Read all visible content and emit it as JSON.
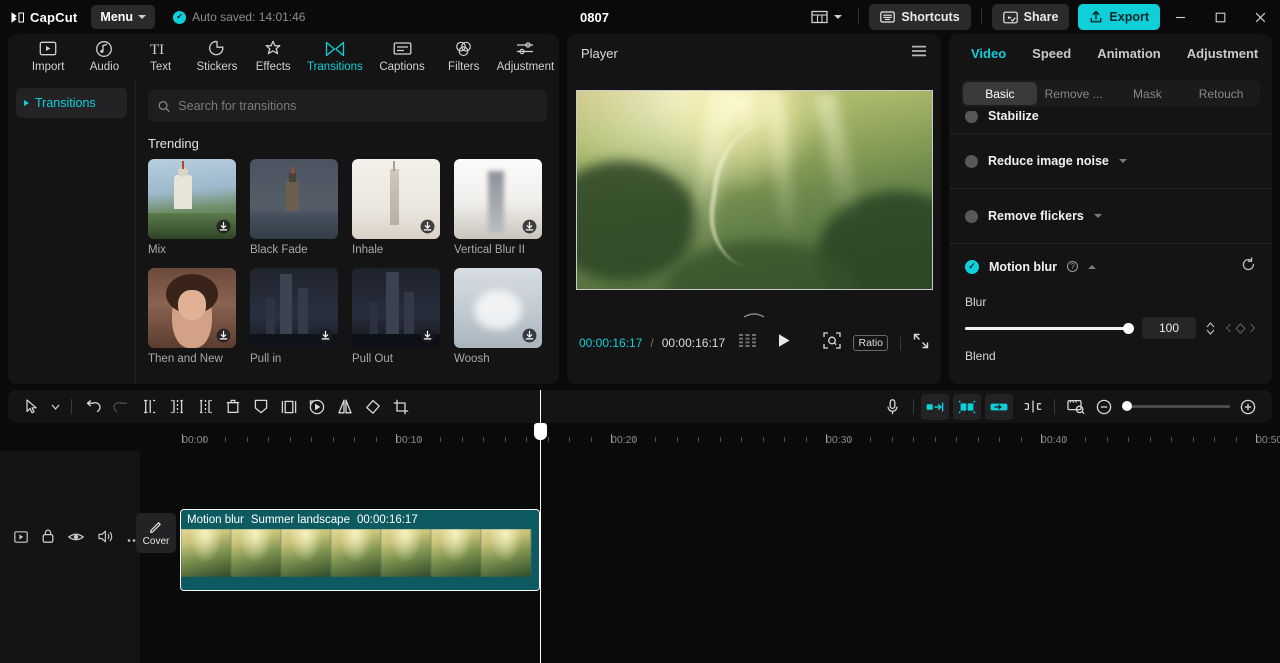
{
  "titlebar": {
    "brand": "CapCut",
    "menu_label": "Menu",
    "autosave_text": "Auto saved: 14:01:46",
    "project_title": "0807",
    "shortcuts_label": "Shortcuts",
    "share_label": "Share",
    "export_label": "Export",
    "icons": {
      "layout": "layout-icon",
      "shortcuts": "keyboard-icon",
      "share": "share-icon",
      "export": "upload-icon",
      "minimize": "–",
      "maximize": "❑",
      "close": "✕"
    },
    "accent_color": "#0fd0d8"
  },
  "nav_tabs": [
    {
      "label": "Import",
      "icon": "import-icon",
      "active": false
    },
    {
      "label": "Audio",
      "icon": "audio-icon",
      "active": false
    },
    {
      "label": "Text",
      "icon": "text-icon",
      "active": false
    },
    {
      "label": "Stickers",
      "icon": "stickers-icon",
      "active": false
    },
    {
      "label": "Effects",
      "icon": "effects-icon",
      "active": false
    },
    {
      "label": "Transitions",
      "icon": "transitions-icon",
      "active": true
    },
    {
      "label": "Captions",
      "icon": "captions-icon",
      "active": false
    },
    {
      "label": "Filters",
      "icon": "filters-icon",
      "active": false
    },
    {
      "label": "Adjustment",
      "icon": "adjustment-icon",
      "active": false
    }
  ],
  "library": {
    "categories": [
      {
        "label": "Transitions",
        "active": true
      }
    ],
    "search_placeholder": "Search for transitions",
    "search_value": "",
    "section_title": "Trending",
    "items": [
      {
        "label": "Mix",
        "download": true,
        "thumb": "lighthouse-day"
      },
      {
        "label": "Black Fade",
        "download": false,
        "thumb": "lighthouse-dusk"
      },
      {
        "label": "Inhale",
        "download": true,
        "thumb": "tower-bright"
      },
      {
        "label": "Vertical Blur II",
        "download": true,
        "thumb": "tower-blur"
      },
      {
        "label": "Then and New",
        "download": true,
        "thumb": "portrait-woman"
      },
      {
        "label": "Pull in",
        "download": true,
        "thumb": "city-night"
      },
      {
        "label": "Pull Out",
        "download": true,
        "thumb": "city-night-2"
      },
      {
        "label": "Woosh",
        "download": true,
        "thumb": "water-splash"
      }
    ]
  },
  "player": {
    "title": "Player",
    "menu_icon": "hamburger-icon",
    "current_time": "00:00:16:17",
    "time_separator": "/",
    "total_time": "00:00:16:17",
    "controls": {
      "frames_icon": "frames-icon",
      "play_icon": "play-icon",
      "focus_icon": "focus-icon",
      "ratio_label": "Ratio",
      "fullscreen_icon": "fullscreen-icon"
    }
  },
  "inspector": {
    "tabs": [
      {
        "label": "Video",
        "active": true
      },
      {
        "label": "Speed",
        "active": false
      },
      {
        "label": "Animation",
        "active": false
      },
      {
        "label": "Adjustment",
        "active": false
      }
    ],
    "segments": [
      {
        "label": "Basic",
        "active": true
      },
      {
        "label": "Remove ...",
        "active": false
      },
      {
        "label": "Mask",
        "active": false
      },
      {
        "label": "Retouch",
        "active": false
      }
    ],
    "rows": [
      {
        "label": "Stabilize",
        "enabled": false,
        "has_caret": false,
        "partial": true
      },
      {
        "label": "Reduce image noise",
        "enabled": false,
        "has_caret": true,
        "partial": false
      },
      {
        "label": "Remove flickers",
        "enabled": false,
        "has_caret": true,
        "partial": false
      },
      {
        "label": "Motion blur",
        "enabled": true,
        "has_caret": true,
        "has_help": true,
        "has_reset": true,
        "partial": false
      }
    ],
    "blur": {
      "label": "Blur",
      "value": "100",
      "percent": 100
    },
    "blend": {
      "label": "Blend"
    }
  },
  "timeline": {
    "toolbar_left": [
      {
        "icon": "select-arrow-icon",
        "name": "select-tool"
      },
      {
        "icon": "chevron-down-icon",
        "name": "tool-dropdown"
      },
      {
        "icon": "undo-icon",
        "name": "undo-button"
      },
      {
        "icon": "redo-icon",
        "name": "redo-button",
        "disabled": true
      },
      {
        "icon": "split-icon",
        "name": "split-button"
      },
      {
        "icon": "trim-left-icon",
        "name": "trim-left-button"
      },
      {
        "icon": "trim-right-icon",
        "name": "trim-right-button"
      },
      {
        "icon": "delete-icon",
        "name": "delete-button"
      },
      {
        "icon": "freeze-icon",
        "name": "freeze-button"
      },
      {
        "icon": "crop-frame-icon",
        "name": "crop-frame-button"
      },
      {
        "icon": "reverse-icon",
        "name": "reverse-button"
      },
      {
        "icon": "mirror-icon",
        "name": "mirror-button"
      },
      {
        "icon": "rotate-icon",
        "name": "rotate-button"
      },
      {
        "icon": "crop-icon",
        "name": "crop-button"
      }
    ],
    "toolbar_right": [
      {
        "icon": "microphone-icon",
        "name": "record-button"
      },
      {
        "icon": "auto-cut-icon",
        "name": "auto-cut-button",
        "active": true
      },
      {
        "icon": "align-icon",
        "name": "align-button",
        "active": true
      },
      {
        "icon": "link-icon",
        "name": "link-button",
        "active": true
      },
      {
        "icon": "adjust-clip-icon",
        "name": "adjust-clip-button"
      },
      {
        "icon": "preview-scale-icon",
        "name": "preview-scale-button"
      },
      {
        "icon": "zoom-out-icon",
        "name": "zoom-out-button"
      },
      {
        "icon": "zoom-in-icon",
        "name": "zoom-in-button"
      }
    ],
    "ruler_labels": [
      "00:00",
      "00:10",
      "00:20",
      "00:30",
      "00:40",
      "00:50"
    ],
    "track_header_icons": [
      {
        "icon": "track-icon",
        "name": "track-type-icon"
      },
      {
        "icon": "lock-icon",
        "name": "lock-track-button"
      },
      {
        "icon": "eye-icon",
        "name": "hide-track-button"
      },
      {
        "icon": "speaker-icon",
        "name": "mute-track-button"
      },
      {
        "icon": "more-icon",
        "name": "track-more-button"
      }
    ],
    "cover_label": "Cover",
    "cover_icon": "pencil-icon",
    "clip": {
      "effect_badge": "Motion blur",
      "name": "Summer landscape",
      "duration": "00:00:16:17"
    }
  }
}
